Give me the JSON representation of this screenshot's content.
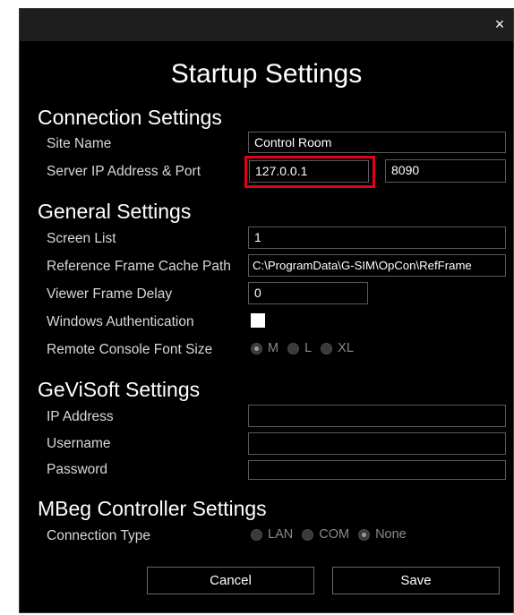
{
  "dialog": {
    "title": "Startup Settings",
    "close_icon": "×"
  },
  "connection": {
    "heading": "Connection Settings",
    "site_name_label": "Site Name",
    "site_name_value": "Control Room",
    "server_label": "Server IP Address & Port",
    "server_ip": "127.0.0.1",
    "server_port": "8090"
  },
  "general": {
    "heading": "General Settings",
    "screen_list_label": "Screen List",
    "screen_list_value": "1",
    "ref_path_label": "Reference Frame Cache Path",
    "ref_path_value": "C:\\ProgramData\\G-SIM\\OpCon\\RefFrame",
    "viewer_delay_label": "Viewer Frame Delay",
    "viewer_delay_value": "0",
    "windows_auth_label": "Windows Authentication",
    "windows_auth_checked": false,
    "font_size_label": "Remote Console Font Size",
    "font_size_options": [
      "M",
      "L",
      "XL"
    ],
    "font_size_selected": "M"
  },
  "gevisoft": {
    "heading": "GeViSoft Settings",
    "ip_label": "IP Address",
    "ip_value": "",
    "username_label": "Username",
    "username_value": "",
    "password_label": "Password",
    "password_value": ""
  },
  "mbeg": {
    "heading": "MBeg Controller Settings",
    "connection_type_label": "Connection Type",
    "connection_type_options": [
      "LAN",
      "COM",
      "None"
    ],
    "connection_type_selected": "None"
  },
  "buttons": {
    "cancel": "Cancel",
    "save": "Save"
  },
  "colors": {
    "background": "#000000",
    "titlebar": "#1e1e1e",
    "highlight": "#e2001a"
  }
}
